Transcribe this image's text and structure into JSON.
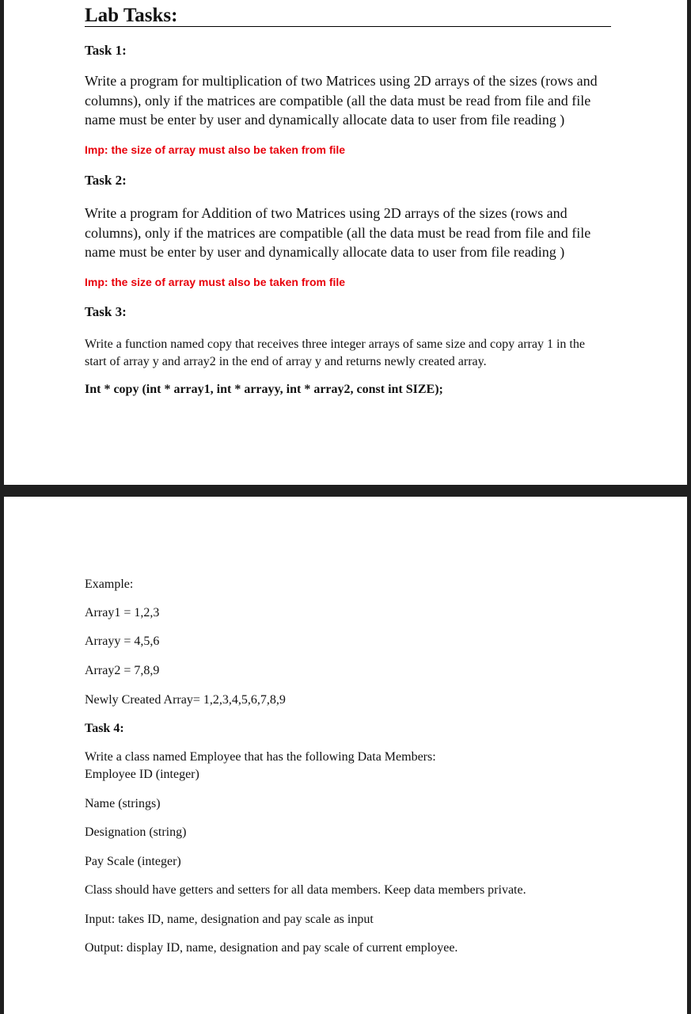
{
  "page1": {
    "heading": "Lab Tasks:",
    "task1": {
      "title": "Task 1:",
      "body": "Write a program for multiplication of two Matrices using 2D arrays of the sizes (rows and columns), only if the matrices are compatible (all the data must be read from file and file name must be enter by user  and dynamically allocate data to user from file reading )",
      "imp": "Imp: the size of array must also be taken from file"
    },
    "task2": {
      "title": "Task 2:",
      "body": "Write a program for Addition of two Matrices using 2D arrays of the sizes (rows and columns), only if the matrices are compatible (all the data must be read from file and file name must be enter by user  and dynamically allocate data to user from file reading )",
      "imp": "Imp: the size of array must also be taken from file"
    },
    "task3": {
      "title": "Task 3:",
      "body": "Write a function named copy that receives three integer arrays of same size and copy array 1 in the start of array y and array2 in the end of array y and returns newly created array.",
      "signature": "Int * copy (int * array1, int * arrayy, int * array2, const int SIZE);"
    }
  },
  "page2": {
    "example_label": "Example:",
    "array1": "Array1 = 1,2,3",
    "arrayy": "Arrayy = 4,5,6",
    "array2": "Array2 = 7,8,9",
    "newly_created": "Newly Created Array= 1,2,3,4,5,6,7,8,9",
    "task4": {
      "title": "Task 4:",
      "intro": "Write a class named Employee that has the following Data Members:",
      "member1": "Employee ID (integer)",
      "member2": "Name (strings)",
      "member3": "Designation (string)",
      "member4": "Pay Scale (integer)",
      "note": "Class should have getters and setters for all data members. Keep data members private.",
      "input": "Input: takes ID, name, designation and pay scale as input",
      "output": "Output: display ID, name, designation and pay scale of current employee."
    }
  }
}
